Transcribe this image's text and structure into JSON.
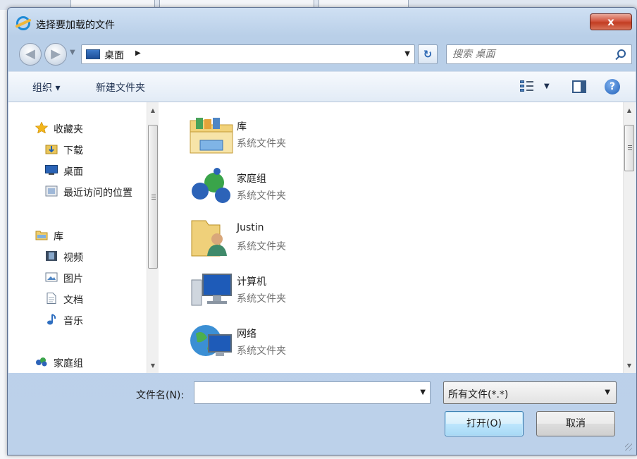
{
  "dialog": {
    "title": "选择要加载的文件",
    "close_label": "x"
  },
  "nav": {
    "address": "桌面",
    "search_placeholder": "搜索 桌面"
  },
  "toolbar": {
    "organize": "组织 ▾",
    "new_folder": "新建文件夹"
  },
  "sidebar": {
    "items": [
      {
        "label": "收藏夹",
        "icon": "star-icon"
      },
      {
        "label": "下载",
        "icon": "download-folder-icon"
      },
      {
        "label": "桌面",
        "icon": "desktop-icon"
      },
      {
        "label": "最近访问的位置",
        "icon": "recent-places-icon"
      },
      {
        "label": "库",
        "icon": "library-icon"
      },
      {
        "label": "视频",
        "icon": "video-icon"
      },
      {
        "label": "图片",
        "icon": "picture-icon"
      },
      {
        "label": "文档",
        "icon": "document-icon"
      },
      {
        "label": "音乐",
        "icon": "music-icon"
      },
      {
        "label": "家庭组",
        "icon": "homegroup-icon"
      }
    ]
  },
  "files": [
    {
      "name": "库",
      "type": "系统文件夹",
      "icon": "library-folder-icon"
    },
    {
      "name": "家庭组",
      "type": "系统文件夹",
      "icon": "homegroup-icon"
    },
    {
      "name": "Justin",
      "type": "系统文件夹",
      "icon": "user-folder-icon"
    },
    {
      "name": "计算机",
      "type": "系统文件夹",
      "icon": "computer-icon"
    },
    {
      "name": "网络",
      "type": "系统文件夹",
      "icon": "network-icon"
    }
  ],
  "footer": {
    "filename_label": "文件名(N):",
    "filename_value": "",
    "filter": "所有文件(*.*)",
    "open": "打开(O)",
    "cancel": "取消"
  }
}
